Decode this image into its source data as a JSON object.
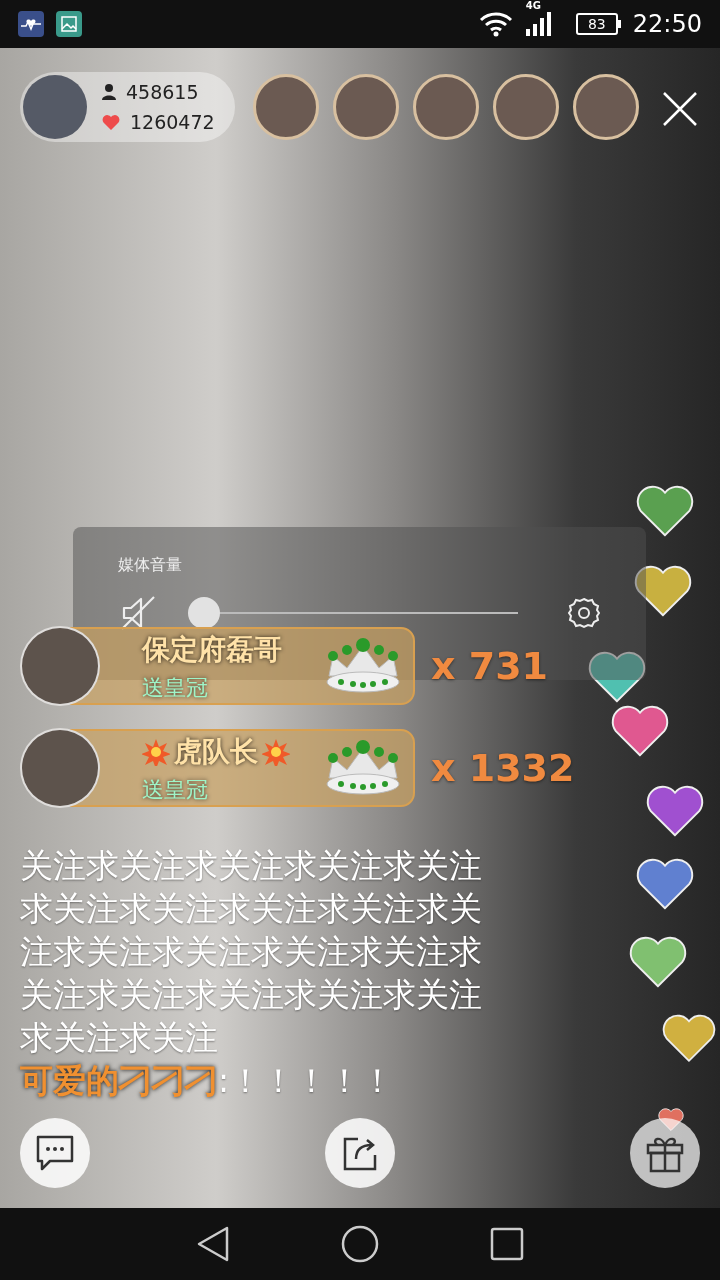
{
  "status_bar": {
    "network": "4G",
    "battery": "83",
    "time": "22:50"
  },
  "host": {
    "viewers": "458615",
    "likes": "1260472"
  },
  "gifts": [
    {
      "name": "保定府磊哥",
      "action": "送皇冠",
      "count": "x 731",
      "emoji": false
    },
    {
      "name": "虎队长",
      "action": "送皇冠",
      "count": "x 1332",
      "emoji": true
    }
  ],
  "chat": [
    {
      "text": "关注求关注求关注求关注求关注求关注求关注求关注求关注求关注求关注求关注求关注求关注求关注求关注求关注求关注求关注求关注求关注"
    },
    {
      "user": "可爱的刁刁刁",
      "text": ":！！！！！"
    }
  ],
  "hearts": [
    {
      "color": "#5aa050"
    },
    {
      "color": "#c8b040"
    },
    {
      "color": "#50c0b0"
    },
    {
      "color": "#e05890"
    },
    {
      "color": "#a050d0"
    },
    {
      "color": "#6080d0"
    },
    {
      "color": "#80c070"
    },
    {
      "color": "#d0b040"
    },
    {
      "color": "#e07060"
    }
  ],
  "volume_panel": {
    "title": "媒体音量",
    "level": 0,
    "muted": true
  }
}
